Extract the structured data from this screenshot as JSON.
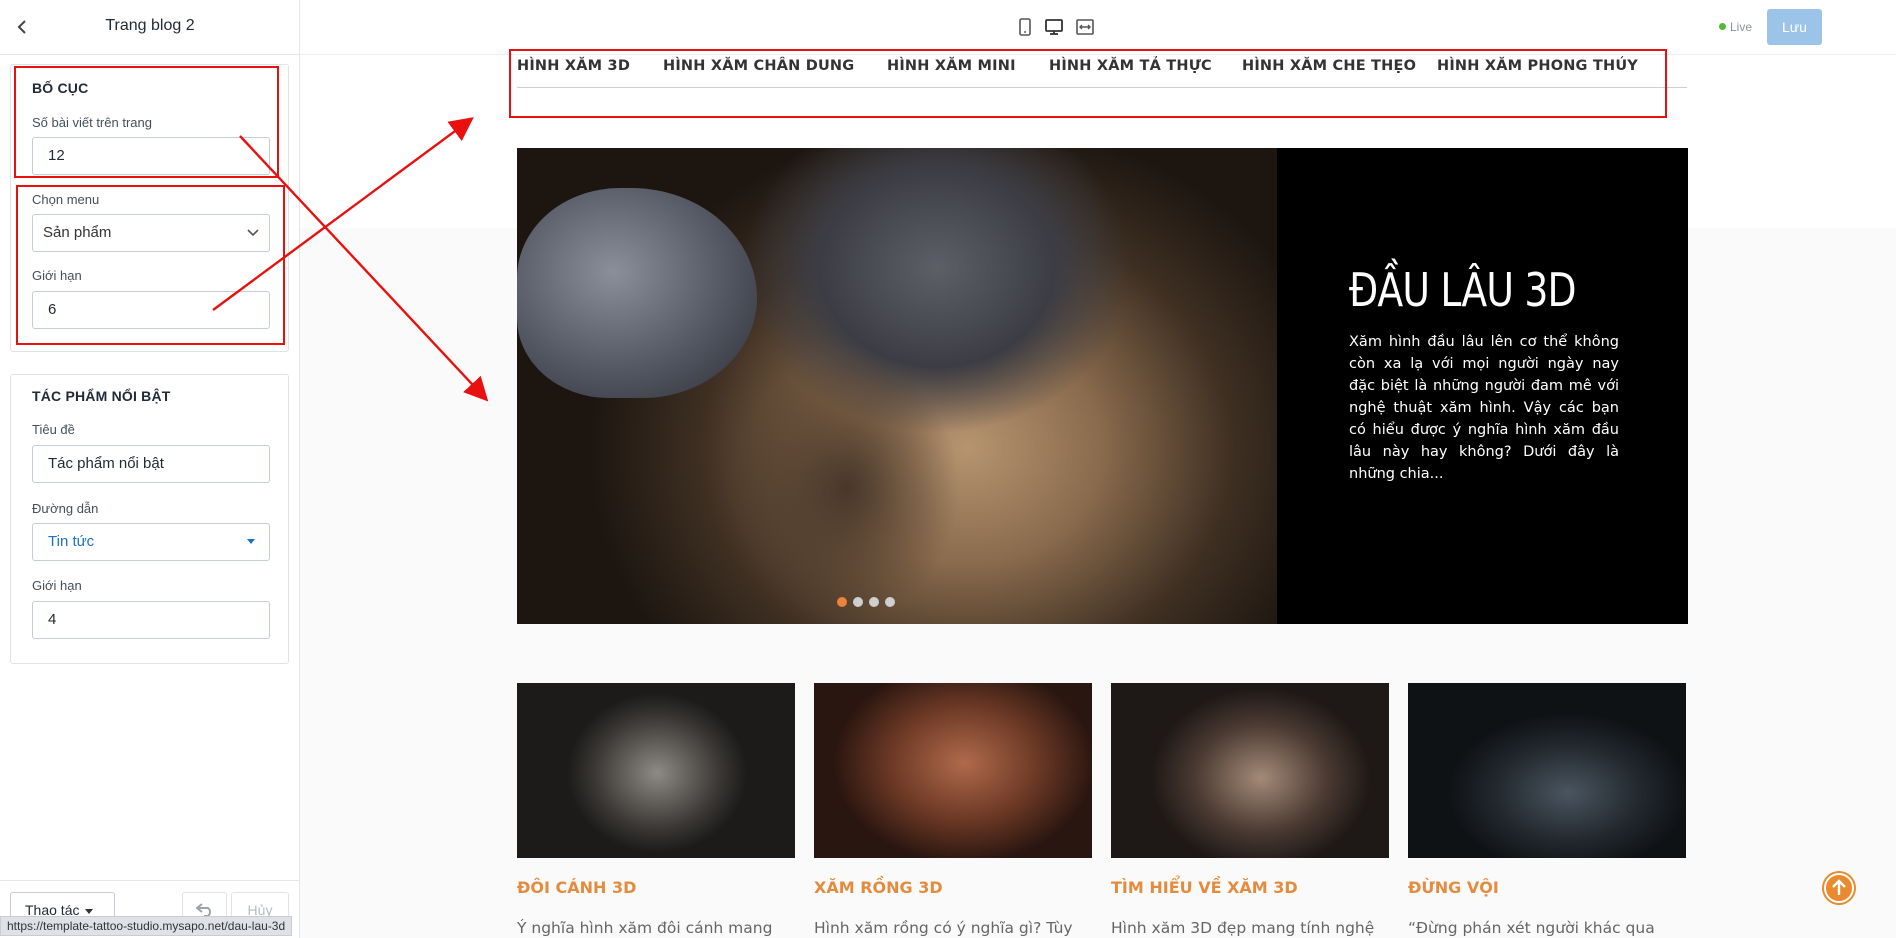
{
  "sidebar": {
    "title": "Trang blog 2",
    "layout": {
      "heading": "BỐ CỤC",
      "posts_label": "Số bài viết trên trang",
      "posts_value": "12",
      "menu_label": "Chọn menu",
      "menu_value": "Sản phẩm",
      "limit_label": "Giới hạn",
      "limit_value": "6"
    },
    "featured": {
      "heading": "TÁC PHẨM NỔI BẬT",
      "title_label": "Tiêu đề",
      "title_value": "Tác phẩm nổi bật",
      "path_label": "Đường dẫn",
      "path_value": "Tin tức",
      "limit_label": "Giới hạn",
      "limit_value": "4"
    },
    "footer": {
      "actions_label": "Thao tác",
      "cancel_label": "Hủy"
    },
    "status_url": "https://template-tattoo-studio.mysapo.net/dau-lau-3d"
  },
  "topbar": {
    "live_label": "Live",
    "save_label": "Lưu",
    "live_color": "#50b83c"
  },
  "nav": {
    "items": [
      "HÌNH XĂM 3D",
      "HÌNH XĂM CHÂN DUNG",
      "HÌNH XĂM MINI",
      "HÌNH XĂM TẢ THỰC",
      "HÌNH XĂM CHE THẸO",
      "HÌNH XĂM PHONG THỦY"
    ]
  },
  "hero": {
    "title": "ĐẦU LÂU 3D",
    "description": "Xăm hình đầu lâu lên cơ thể không còn xa lạ với mọi người ngày nay đặc biệt là những người đam mê với nghệ thuật xăm hình. Vậy các bạn có hiểu được ý nghĩa hình xăm đầu lâu này hay không? Dưới đây là những chia..."
  },
  "cards": [
    {
      "title": "ĐÔI CÁNH 3D",
      "excerpt": "Ý nghĩa hình xăm đôi cánh mang"
    },
    {
      "title": "XĂM RỒNG 3D",
      "excerpt": "Hình xăm rồng có ý nghĩa gì? Tùy"
    },
    {
      "title": "TÌM HIỂU VỀ XĂM 3D",
      "excerpt": "Hình xăm 3D đẹp mang tính nghệ"
    },
    {
      "title": "ĐỪNG VỘI",
      "excerpt": "“Đừng phán xét người khác qua"
    }
  ],
  "colors": {
    "accent": "#e38c3f",
    "annotation": "#e8110f",
    "save_button": "#9cc4e8"
  }
}
